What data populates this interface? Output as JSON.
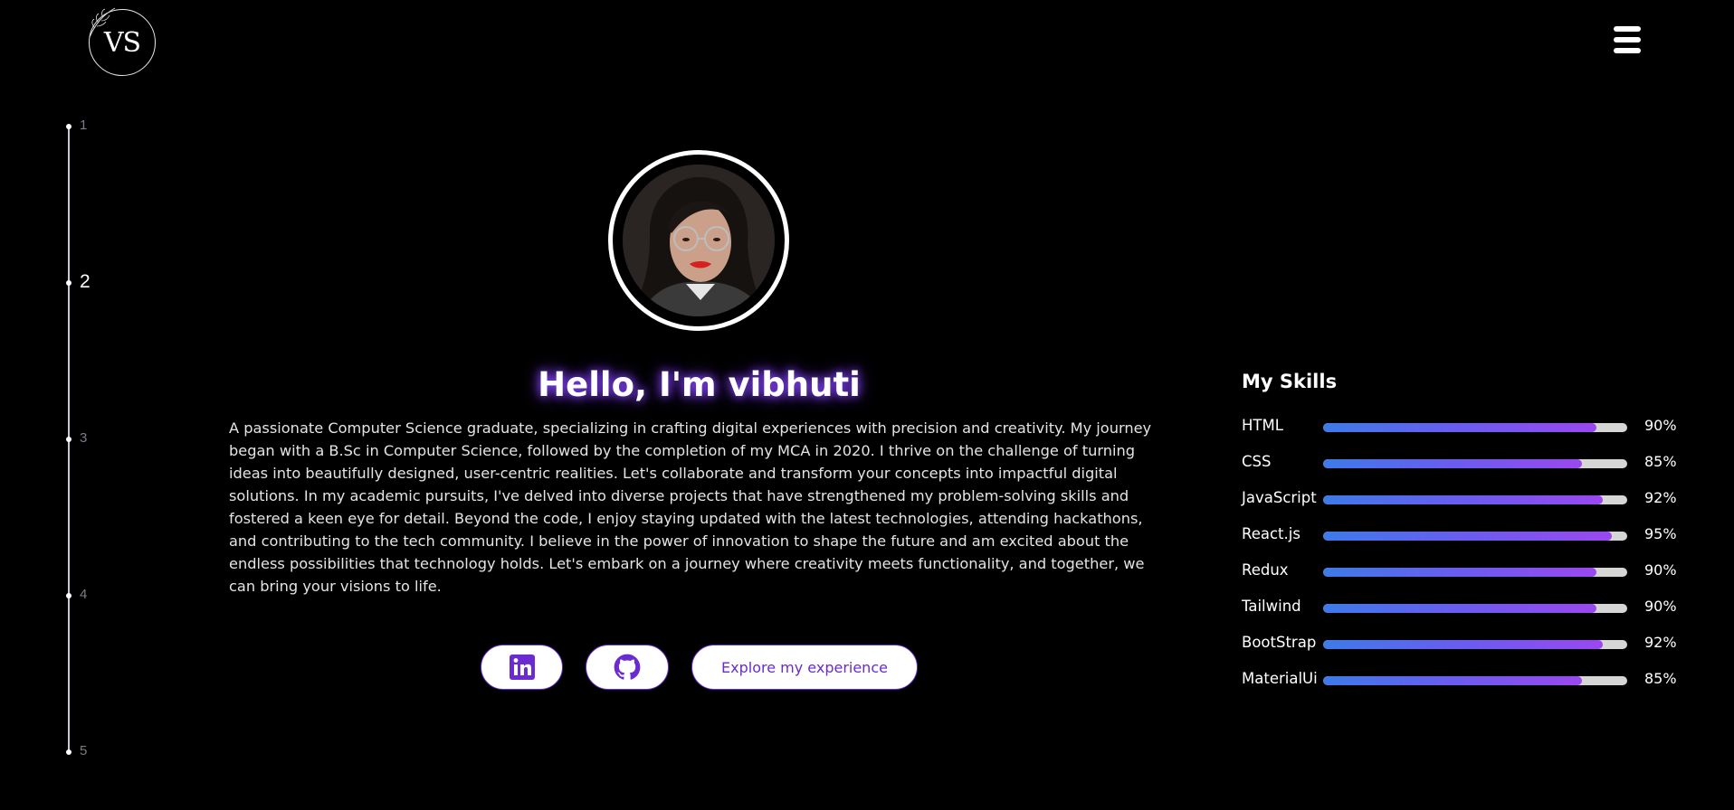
{
  "logo": {
    "text": "VS"
  },
  "menu": {
    "icon": "hamburger-menu-icon"
  },
  "section_nav": {
    "items": [
      {
        "label": "1"
      },
      {
        "label": "2"
      },
      {
        "label": "3"
      },
      {
        "label": "4"
      },
      {
        "label": "5"
      }
    ],
    "active": "2"
  },
  "hero": {
    "title": "Hello, I'm vibhuti",
    "bio": "A passionate Computer Science graduate, specializing in crafting digital experiences with precision and creativity. My journey began with a B.Sc in Computer Science, followed by the completion of my MCA in 2020. I thrive on the challenge of turning ideas into beautifully designed, user-centric realities. Let's collaborate and transform your concepts into impactful digital solutions. In my academic pursuits, I've delved into diverse projects that have strengthened my problem-solving skills and fostered a keen eye for detail. Beyond the code, I enjoy staying updated with the latest technologies, attending hackathons, and contributing to the tech community. I believe in the power of innovation to shape the future and am excited about the endless possibilities that technology holds. Let's embark on a journey where creativity meets functionality, and together, we can bring your visions to life."
  },
  "actions": {
    "linkedin_icon": "linkedin-icon",
    "github_icon": "github-icon",
    "explore_label": "Explore my experience"
  },
  "skills": {
    "title": "My Skills",
    "items": [
      {
        "name": "HTML",
        "percent": 90,
        "label": "90%"
      },
      {
        "name": "CSS",
        "percent": 85,
        "label": "85%"
      },
      {
        "name": "JavaScript",
        "percent": 92,
        "label": "92%"
      },
      {
        "name": "React.js",
        "percent": 95,
        "label": "95%"
      },
      {
        "name": "Redux",
        "percent": 90,
        "label": "90%"
      },
      {
        "name": "Tailwind",
        "percent": 90,
        "label": "90%"
      },
      {
        "name": "BootStrap",
        "percent": 92,
        "label": "92%"
      },
      {
        "name": "MaterialUi",
        "percent": 85,
        "label": "85%"
      }
    ]
  },
  "colors": {
    "background": "#000000",
    "accent": "#6a2bd1",
    "glow": "#8a46ff",
    "bar_start": "#3d7be8",
    "bar_end": "#9a48ef"
  }
}
